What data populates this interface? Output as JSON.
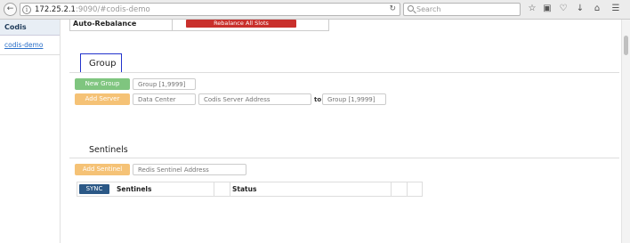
{
  "browser": {
    "url_host": "172.25.2.1",
    "url_rest": ":9090/#codis-demo",
    "search_placeholder": "Search"
  },
  "sidebar": {
    "title": "Codis",
    "items": [
      {
        "label": "codis-demo"
      }
    ]
  },
  "rebalance": {
    "label": "Auto-Rebalance",
    "button_label": "Rebalance All Slots"
  },
  "group": {
    "heading": "Group",
    "new_group_label": "New Group",
    "group_placeholder": "Group [1,9999]",
    "add_server_label": "Add Server",
    "data_center_placeholder": "Data Center",
    "server_address_placeholder": "Codis Server Address",
    "to_label": "to",
    "target_group_placeholder": "Group [1,9999]"
  },
  "sentinels": {
    "heading": "Sentinels",
    "add_sentinel_label": "Add Sentinel",
    "address_placeholder": "Redis Sentinel Address",
    "sync_label": "SYNC",
    "columns": [
      "Sentinels",
      "Status"
    ]
  },
  "colors": {
    "danger": "#c9302c",
    "success": "#7fc57f",
    "warning": "#f5c276",
    "primary": "#2b5886",
    "highlight_border": "#2233cc"
  }
}
